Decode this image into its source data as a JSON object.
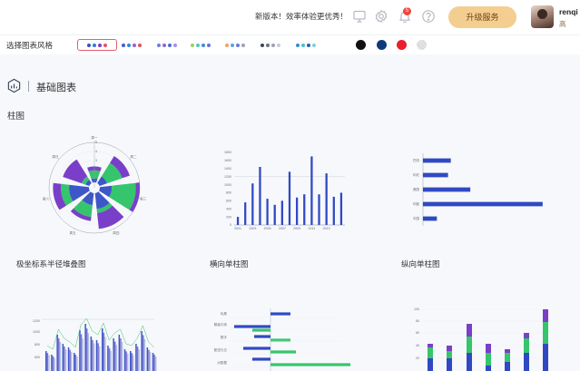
{
  "header": {
    "promo": "新版本！效率体验更优秀！",
    "notif_count": "5",
    "upgrade_label": "升级服务",
    "user_name": "renqi",
    "user_sub": "高"
  },
  "style_bar": {
    "label": "选择图表风格",
    "palettes": [
      [
        "#3c4ec5",
        "#2f7bd8",
        "#7b3fc2",
        "#e9506b"
      ],
      [
        "#3f5bd5",
        "#2f87e0",
        "#9b5dd4",
        "#d8546b"
      ],
      [
        "#6f7de0",
        "#8c67cf",
        "#4c6ad6",
        "#a88ee6"
      ],
      [
        "#9bd15a",
        "#5cc1c8",
        "#3f8be0",
        "#6a6ee0"
      ],
      [
        "#f2a25f",
        "#5b9ee8",
        "#6a7ad8",
        "#9aa3b5"
      ],
      [
        "#3d4555",
        "#6a7383",
        "#9ba4b2",
        "#c6cbd3"
      ],
      [
        "#2c8fd6",
        "#4bc1c9",
        "#2e5fb8",
        "#7ed0d8"
      ]
    ],
    "solids": [
      "#111111",
      "#0d3b7a",
      "#e8202c",
      "#d9d9d9"
    ]
  },
  "section": {
    "title": "基础图表"
  },
  "group": {
    "title": "柱图"
  },
  "cards": [
    {
      "caption": "极坐标系半径堆叠图"
    },
    {
      "caption": "横向单柱图"
    },
    {
      "caption": "纵向单柱图"
    }
  ],
  "chart_data": [
    {
      "type": "bar",
      "subtype": "polar-radius-stacked",
      "categories": [
        "周一",
        "周二",
        "周三",
        "周四",
        "周五",
        "周六",
        "周日"
      ],
      "rticks": [
        "1",
        "2",
        "3",
        "4",
        "5"
      ],
      "series": [
        {
          "color": "#3d57c9",
          "values": [
            1,
            2,
            3,
            4,
            3,
            5,
            1
          ]
        },
        {
          "color": "#35c56c",
          "values": [
            2,
            4,
            6,
            1,
            3,
            2,
            1
          ]
        },
        {
          "color": "#7a3fc8",
          "values": [
            1,
            2,
            3,
            4,
            1,
            2,
            5
          ]
        }
      ]
    },
    {
      "type": "bar",
      "orientation": "vertical",
      "categories": [
        "2001",
        "2002",
        "2003",
        "2004",
        "2005",
        "2006",
        "2007",
        "2008",
        "2009",
        "2010",
        "2011",
        "2012",
        "2013",
        "2014",
        "2015"
      ],
      "values": [
        200,
        560,
        1030,
        1440,
        650,
        500,
        600,
        1320,
        680,
        760,
        1700,
        760,
        1280,
        700,
        800
      ],
      "ylim": [
        0,
        1800
      ],
      "yticks": [
        "0",
        "200",
        "400",
        "600",
        "800",
        "1000",
        "1200",
        "1400",
        "1600",
        "1800"
      ],
      "xticks": [
        "2001",
        "2003",
        "2005",
        "2007",
        "2009",
        "2011",
        "2013"
      ],
      "color": "#3049c3"
    },
    {
      "type": "bar",
      "orientation": "horizontal",
      "categories": [
        "巴西",
        "印尼",
        "美国",
        "印度",
        "中国"
      ],
      "values": [
        10,
        9,
        17,
        43,
        5
      ],
      "xlim": [
        0,
        45
      ],
      "ytick_labels": [
        "巴西",
        "印尼",
        "美国",
        "印度",
        "中国"
      ],
      "color": "#3049c3"
    },
    {
      "type": "bar",
      "subtype": "grouped-with-line",
      "colors": [
        "#3a57c9",
        "#7d72c9",
        "#b1c0e8"
      ],
      "yticks": [
        "1200",
        "1000",
        "800",
        "600"
      ]
    },
    {
      "type": "bar",
      "subtype": "positive-negative-horizontal",
      "categories": [
        "玩具",
        "服装与饰",
        "数字",
        "配送与交",
        "大数据"
      ],
      "colors": [
        "#3049c3",
        "#35c56c"
      ]
    },
    {
      "type": "bar",
      "subtype": "stacked-vertical",
      "colors": [
        "#3049c3",
        "#35c56c",
        "#7a3fc8"
      ],
      "yticks": [
        "100",
        "80",
        "60",
        "40",
        "20"
      ]
    }
  ]
}
